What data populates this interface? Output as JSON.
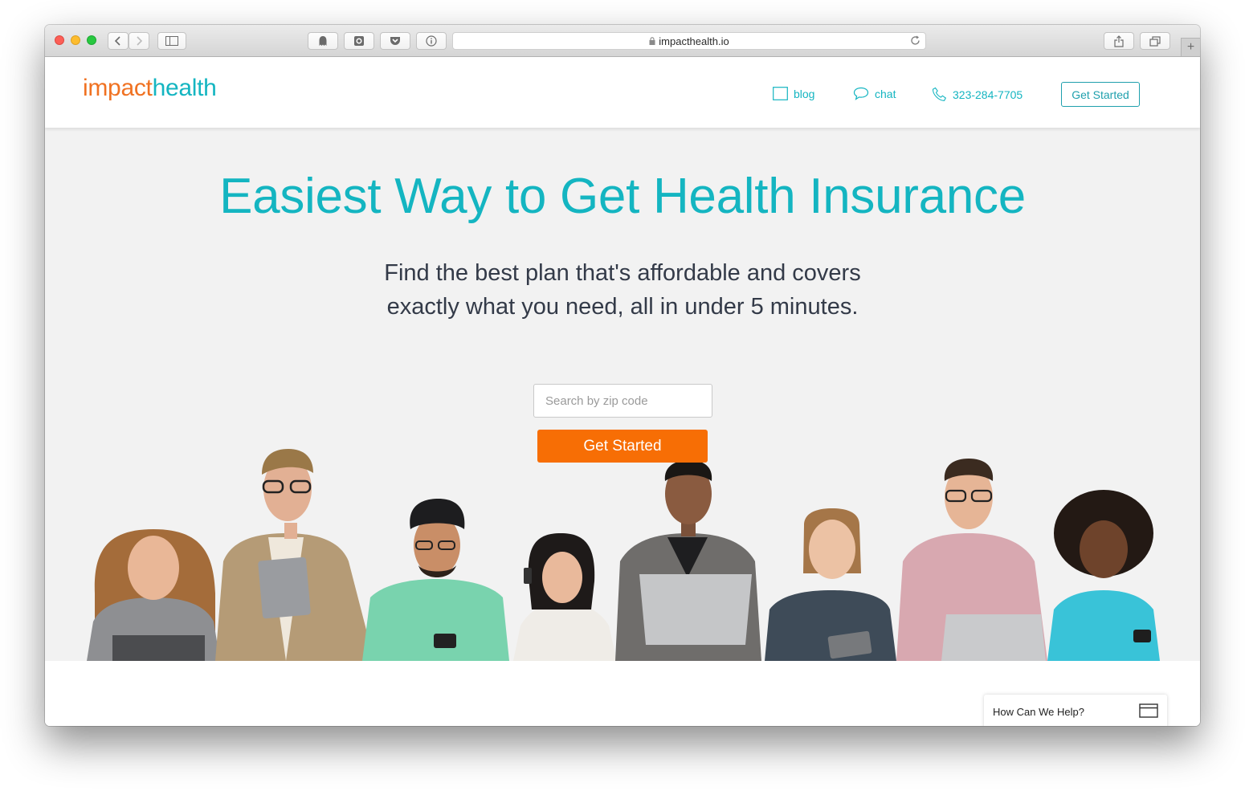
{
  "browser": {
    "url": "impacthealth.io",
    "newtab_symbol": "+"
  },
  "nav": {
    "logo_part1": "impact",
    "logo_part2": "health",
    "blog_label": "blog",
    "chat_label": "chat",
    "phone": "323-284-7705",
    "cta_label": "Get Started"
  },
  "hero": {
    "headline": "Easiest Way to Get Health Insurance",
    "subtitle": "Find the best plan that's affordable and covers exactly what you need, all in under 5 minutes.",
    "zip_placeholder": "Search by zip code",
    "cta_label": "Get Started"
  },
  "help_widget": {
    "label": "How Can We Help?"
  },
  "colors": {
    "brand_teal": "#14b5c1",
    "brand_orange": "#f07222",
    "cta_orange": "#f76e05",
    "hero_bg": "#f2f2f2",
    "text_dark": "#333a48"
  },
  "icons": [
    "back-arrow-icon",
    "forward-arrow-icon",
    "sidebar-icon",
    "ghostery-icon",
    "camera-icon",
    "pocket-icon",
    "info-icon",
    "lock-icon",
    "reload-icon",
    "share-icon",
    "tabs-icon",
    "blog-icon",
    "chat-icon",
    "phone-icon",
    "help-window-icon"
  ]
}
